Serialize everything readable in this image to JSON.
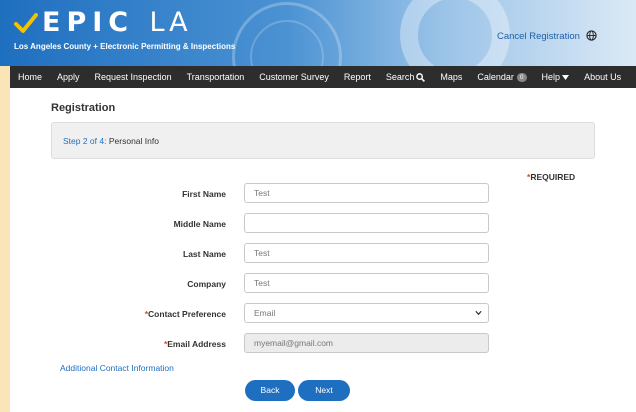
{
  "header": {
    "logo_main": "EPIC",
    "logo_la": "LA",
    "logo_subtitle": "Los Angeles County + Electronic Permitting & Inspections",
    "cancel_label": "Cancel Registration",
    "globe_icon": "globe-icon"
  },
  "nav": {
    "items": [
      {
        "label": "Home"
      },
      {
        "label": "Apply"
      },
      {
        "label": "Request Inspection"
      },
      {
        "label": "Transportation"
      },
      {
        "label": "Customer Survey"
      },
      {
        "label": "Report"
      },
      {
        "label": "Search",
        "icon": "search-icon"
      },
      {
        "label": "Maps"
      },
      {
        "label": "Calendar",
        "badge": "0"
      },
      {
        "label": "Help",
        "icon": "caret-down-icon"
      },
      {
        "label": "About Us"
      }
    ]
  },
  "page": {
    "title": "Registration",
    "step_count": "Step 2 of 4:",
    "step_name": "Personal Info",
    "required_note": "REQUIRED",
    "required_mark": "*"
  },
  "form": {
    "first_name": {
      "label": "First Name",
      "value": "Test"
    },
    "middle_name": {
      "label": "Middle Name",
      "value": ""
    },
    "last_name": {
      "label": "Last Name",
      "value": "Test"
    },
    "company": {
      "label": "Company",
      "value": "Test"
    },
    "contact_pref": {
      "label": "Contact Preference",
      "value": "Email"
    },
    "email": {
      "label": "Email Address",
      "value": "myemail@gmail.com"
    }
  },
  "links": {
    "additional_contact": "Additional Contact Information"
  },
  "buttons": {
    "back": "Back",
    "next": "Next"
  },
  "colors": {
    "accent": "#1f6fc0",
    "nav_bg": "#2d2d2d",
    "page_bg": "#fbe5b8",
    "required": "#d42"
  }
}
